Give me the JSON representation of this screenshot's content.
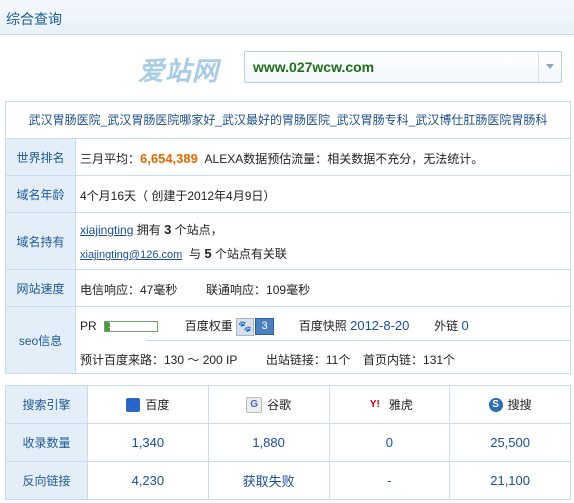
{
  "header": {
    "title": "综合查询"
  },
  "search": {
    "logo": "爱站网",
    "domain": "www.027wcw.com"
  },
  "site_title": "武汉胃肠医院_武汉胃肠医院哪家好_武汉最好的胃肠医院_武汉胃肠专科_武汉博仕肛肠医院胃肠科",
  "rank": {
    "label": "世界排名",
    "prefix": "三月平均：",
    "value": "6,654,389",
    "suffix": "ALEXA数据预估流量：相关数据不充分，无法统计。"
  },
  "age": {
    "label": "域名年龄",
    "text": "4个月16天（ 创建于2012年4月9日）"
  },
  "owner": {
    "label": "域名持有",
    "name": "xiajingting",
    "owns_pre": "拥有",
    "owns_count": "3",
    "owns_post": "个站点，",
    "email": "xiajingting@126.com",
    "assoc_pre": "与",
    "assoc_count": "5",
    "assoc_post": "个站点有关联"
  },
  "speed": {
    "label": "网站速度",
    "telecom": "电信响应：47毫秒",
    "unicom": "联通响应：109毫秒"
  },
  "seo": {
    "label": "seo信息",
    "pr_label": "PR",
    "pr_value": "1",
    "pr_fraction": 0.1,
    "baidu_weight_label": "百度权重",
    "baidu_weight_value": "3",
    "snapshot_label": "百度快照",
    "snapshot_value": "2012-8-20",
    "outlink_label": "外链",
    "outlink_value": "0",
    "traffic": "预计百度来路：130 ～ 200 IP",
    "out_links": "出站链接：11个",
    "home_inlinks": "首页内链：131个"
  },
  "engines": {
    "header_label": "搜索引擎",
    "names": [
      "百度",
      "谷歌",
      "雅虎",
      "搜搜"
    ],
    "icons": [
      "baidu-icon",
      "google-icon",
      "yahoo-icon",
      "soso-icon"
    ],
    "index_label": "收录数量",
    "index_values": [
      "1,340",
      "1,880",
      "0",
      "25,500"
    ],
    "backlink_label": "反向链接",
    "backlink_values": [
      "4,230",
      "获取失败",
      "-",
      "21,100"
    ]
  },
  "colors": {
    "accent": "#1e5a96",
    "label_bg": "#e3eef8",
    "orange": "#e26a00",
    "border": "#c8dcef"
  }
}
